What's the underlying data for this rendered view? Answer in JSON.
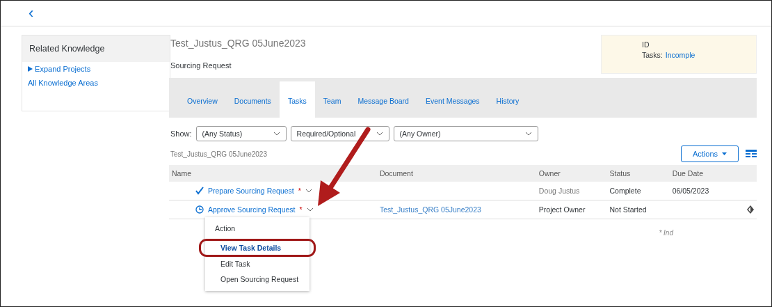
{
  "header": {
    "back": "‹"
  },
  "sidebar": {
    "title": "Related Knowledge",
    "links": [
      {
        "label": "Expand Projects",
        "kind": "expander"
      },
      {
        "label": "All Knowledge Areas",
        "kind": "link"
      }
    ]
  },
  "page": {
    "title": "Test_Justus_QRG 05June2023",
    "subtitle": "Sourcing Request"
  },
  "info": {
    "id_label": "ID",
    "tasks_label": "Tasks:",
    "tasks_value": "Incomple"
  },
  "tabs": [
    {
      "label": "Overview",
      "selected": false
    },
    {
      "label": "Documents",
      "selected": false
    },
    {
      "label": "Tasks",
      "selected": true
    },
    {
      "label": "Team",
      "selected": false
    },
    {
      "label": "Message Board",
      "selected": false
    },
    {
      "label": "Event Messages",
      "selected": false
    },
    {
      "label": "History",
      "selected": false
    }
  ],
  "filters": {
    "label": "Show:",
    "selects": [
      {
        "value": "(Any Status)"
      },
      {
        "value": "Required/Optional"
      },
      {
        "value": "(Any Owner)"
      }
    ]
  },
  "project_name": "Test_Justus_QRG 05June2023",
  "actions_button": "Actions",
  "table": {
    "columns": [
      "Name",
      "Document",
      "Owner",
      "Status",
      "Due Date"
    ],
    "rows": [
      {
        "kind": "done",
        "name": "Prepare Sourcing Request",
        "required_mark": "*",
        "document": "",
        "owner": "Doug Justus",
        "status": "Complete",
        "due": "06/05/2023",
        "menu": false
      },
      {
        "kind": "pending",
        "name": "Approve Sourcing Request",
        "required_mark": "*",
        "document": "Test_Justus_QRG 05June2023",
        "owner": "Project Owner",
        "status": "Not Started",
        "due": "",
        "menu": true
      }
    ]
  },
  "footnote": "* Ind",
  "row_menu": {
    "title": "Action",
    "items": [
      {
        "label": "View Task Details",
        "highlighted": true
      },
      {
        "label": "Edit Task",
        "highlighted": false
      },
      {
        "label": "Open Sourcing Request",
        "highlighted": false
      }
    ]
  }
}
